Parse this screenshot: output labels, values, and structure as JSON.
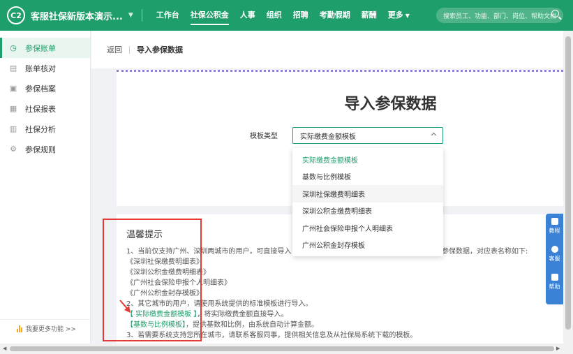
{
  "topbar": {
    "logo": "C2",
    "app_title": "客服社保新版本演示...",
    "nav": [
      "工作台",
      "社保公积金",
      "人事",
      "组织",
      "招聘",
      "考勤假期",
      "薪酬",
      "更多"
    ],
    "active_nav": "社保公积金",
    "search_placeholder": "搜索员工、功能、部门、岗位、帮助文档"
  },
  "sidebar": {
    "items": [
      {
        "label": "参保账单",
        "icon": "bill-icon",
        "active": true
      },
      {
        "label": "账单核对",
        "icon": "check-list-icon",
        "active": false
      },
      {
        "label": "参保档案",
        "icon": "archive-icon",
        "active": false
      },
      {
        "label": "社保报表",
        "icon": "report-icon",
        "active": false
      },
      {
        "label": "社保分析",
        "icon": "analysis-chart-icon",
        "active": false
      },
      {
        "label": "参保规则",
        "icon": "settings-rule-icon",
        "active": false
      }
    ],
    "bottom_label": "我要更多功能 >>"
  },
  "breadcrumb": {
    "back": "返回",
    "current": "导入参保数据"
  },
  "import_card": {
    "title": "导入参保数据",
    "template_label": "模板类型",
    "selected_template": "实际缴费金额模板"
  },
  "dropdown": {
    "options": [
      "实际缴费金额模板",
      "基数与比例模板",
      "深圳社保缴费明细表",
      "深圳公积金缴费明细表",
      "广州社会保险申报个人明细表",
      "广州公积金封存模板"
    ],
    "selected_index": 0,
    "hover_index": 2
  },
  "tips": {
    "title": "温馨提示",
    "line1": "1、当前仅支持广州、深圳两城市的用户，可直接导入",
    "line1_tail": "参保数据，对应表名称如下:",
    "files": [
      "《深圳社保缴费明细表》",
      "《深圳公积金缴费明细表》",
      "《广州社会保险申报个人明细表》",
      "《广州公积金封存模板》"
    ],
    "line2": "2、其它城市的用户，请使用系统提供的标准模板进行导入。",
    "tpl1": "【 实际缴费金额模板 】",
    "tpl1_desc": "，将实际缴费金额直接导入。",
    "tpl2": "【基数与比例模板】",
    "tpl2_desc": "，提供基数和比例，由系统自动计算金额。",
    "line3": "3、若需要系统支持您所在城市，请联系客服同事，提供相关信息及从社保局系统下载的模板。"
  },
  "float_panel": {
    "items": [
      {
        "label": "教程",
        "icon": "tutorial-icon"
      },
      {
        "label": "客服",
        "icon": "chat-icon"
      },
      {
        "label": "帮助",
        "icon": "help-doc-icon"
      }
    ]
  }
}
